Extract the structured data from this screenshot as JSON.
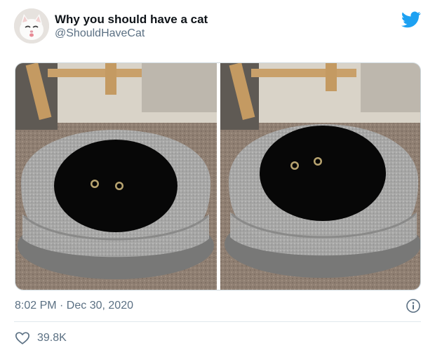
{
  "tweet": {
    "author": {
      "display_name": "Why you should have a cat",
      "handle": "@ShouldHaveCat",
      "avatar_icon": "white-cat-avatar"
    },
    "brand_icon": "twitter-bird-icon",
    "media": [
      {
        "icon": "cat-cave-photo-eyes-low"
      },
      {
        "icon": "cat-cave-photo-eyes-high"
      }
    ],
    "timestamp": "8:02 PM · Dec 30, 2020",
    "info_icon": "info-icon",
    "likes": {
      "icon": "heart-icon",
      "count": "39.8K"
    },
    "colors": {
      "twitter_blue": "#1da1f2",
      "secondary_text": "#5b7083",
      "primary_text": "#0f1419",
      "divider": "#e1e8ed"
    }
  }
}
